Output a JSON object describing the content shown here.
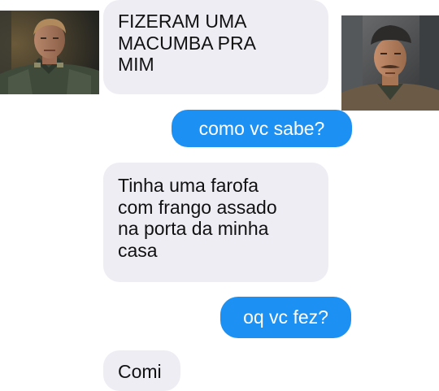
{
  "messages": [
    {
      "side": "received",
      "text": "FIZERAM UMA\nMACUMBA PRA\nMIM"
    },
    {
      "side": "sent",
      "text": "como vc sabe?"
    },
    {
      "side": "received",
      "text": "Tinha uma farofa\ncom frango assado\nna porta da minha\ncasa"
    },
    {
      "side": "sent",
      "text": "oq vc fez?"
    },
    {
      "side": "received",
      "text": "Comi"
    }
  ],
  "colors": {
    "received_bubble": "#efedf4",
    "sent_bubble": "#1c90f3",
    "sent_text": "#ffffff",
    "received_text": "#111111"
  },
  "photos": {
    "left": "avatar-left-officer-photo",
    "right": "avatar-right-officer-photo"
  }
}
